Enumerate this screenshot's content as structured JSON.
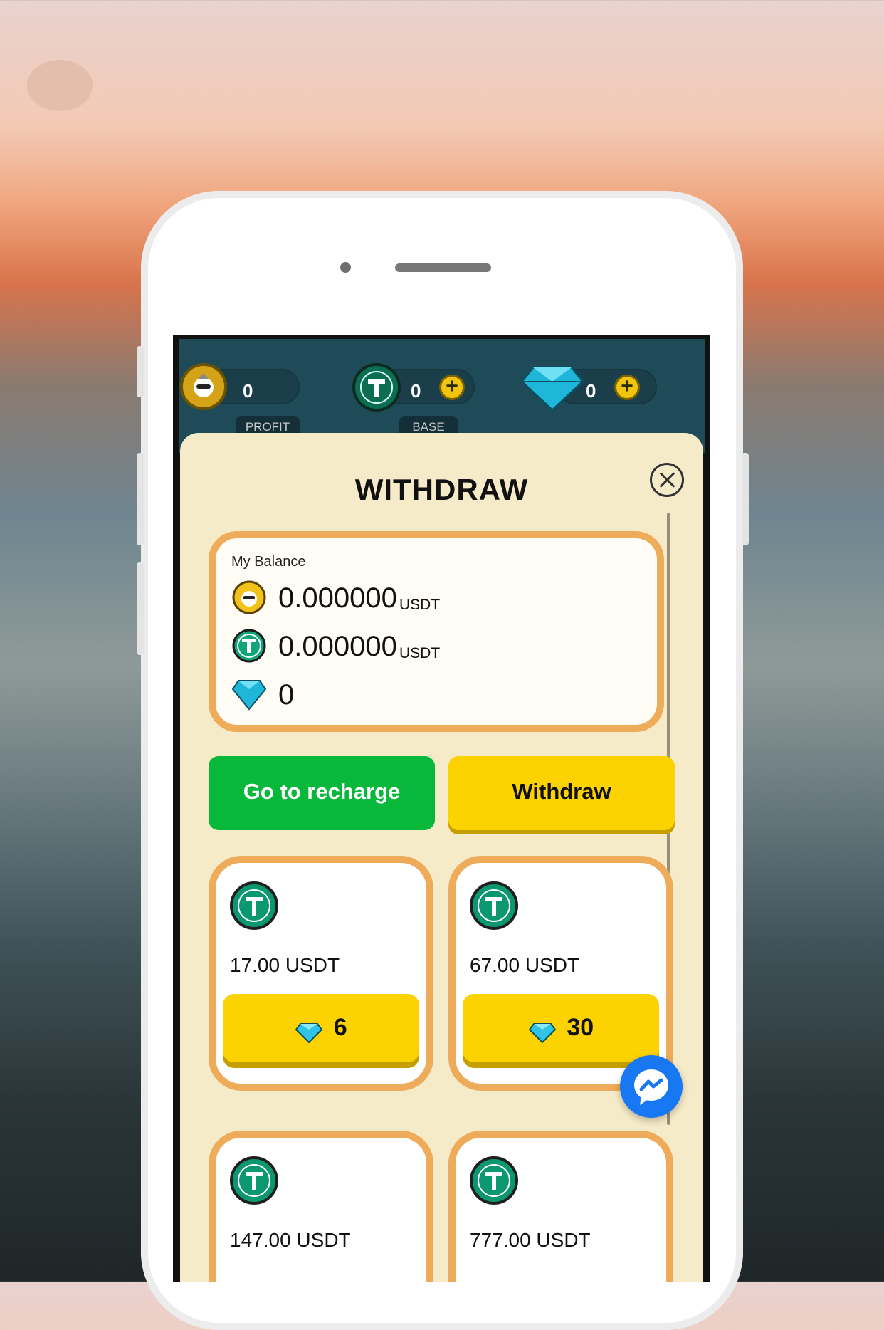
{
  "top_bar": {
    "profit_value": "0",
    "base_value": "0",
    "gem_value": "0",
    "profit_tag": "PROFIT",
    "base_tag": "BASE"
  },
  "panel": {
    "title": "WITHDRAW",
    "balance": {
      "label": "My Balance",
      "profit_amount": "0.000000",
      "profit_unit": "USDT",
      "base_amount": "0.000000",
      "base_unit": "USDT",
      "gems": "0"
    },
    "buttons": {
      "recharge": "Go to recharge",
      "withdraw": "Withdraw"
    },
    "options": [
      {
        "amount": "17.00 USDT",
        "gems": "6"
      },
      {
        "amount": "67.00 USDT",
        "gems": "30"
      },
      {
        "amount": "147.00 USDT",
        "gems": ""
      },
      {
        "amount": "777.00 USDT",
        "gems": ""
      }
    ]
  },
  "colors": {
    "accent_green": "#07b83b",
    "accent_yellow": "#fcd200",
    "card_border": "#eeab5a",
    "panel_bg": "#f6ebc8",
    "messenger_blue": "#1877f2"
  },
  "icons": [
    "profit-coin-icon",
    "tether-icon",
    "diamond-icon",
    "plus-icon",
    "close-icon",
    "messenger-icon"
  ]
}
